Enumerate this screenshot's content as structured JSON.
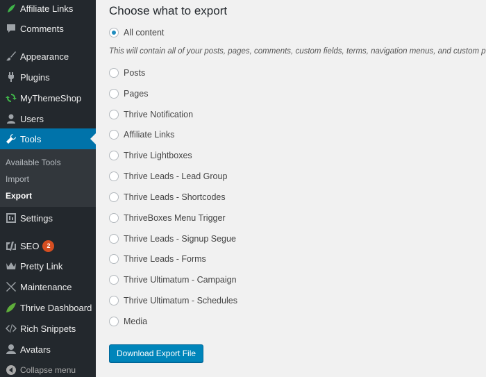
{
  "sidebar": {
    "items": [
      {
        "key": "affiliate",
        "label": "Affiliate Links",
        "icon": "leaf-icon"
      },
      {
        "key": "comments",
        "label": "Comments",
        "icon": "comment-icon"
      },
      {
        "key": "appearance",
        "label": "Appearance",
        "icon": "brush-icon"
      },
      {
        "key": "plugins",
        "label": "Plugins",
        "icon": "plug-icon"
      },
      {
        "key": "mythemeshop",
        "label": "MyThemeShop",
        "icon": "refresh-icon"
      },
      {
        "key": "users",
        "label": "Users",
        "icon": "user-icon"
      },
      {
        "key": "tools",
        "label": "Tools",
        "icon": "wrench-icon"
      },
      {
        "key": "settings",
        "label": "Settings",
        "icon": "settings-icon"
      },
      {
        "key": "seo",
        "label": "SEO",
        "icon": "yoast-icon",
        "badge": "2"
      },
      {
        "key": "prettylink",
        "label": "Pretty Link",
        "icon": "crown-icon"
      },
      {
        "key": "maintenance",
        "label": "Maintenance",
        "icon": "tools-icon"
      },
      {
        "key": "thrive",
        "label": "Thrive Dashboard",
        "icon": "thrive-leaf-icon"
      },
      {
        "key": "snippets",
        "label": "Rich Snippets",
        "icon": "code-icon"
      },
      {
        "key": "avatars",
        "label": "Avatars",
        "icon": "avatar-icon"
      }
    ],
    "submenu": [
      "Available Tools",
      "Import",
      "Export"
    ],
    "collapse_label": "Collapse menu"
  },
  "main": {
    "heading": "Choose what to export",
    "all_content_label": "All content",
    "description": "This will contain all of your posts, pages, comments, custom fields, terms, navigation menus, and custom posts.",
    "options": [
      "Posts",
      "Pages",
      "Thrive Notification",
      "Affiliate Links",
      "Thrive Lightboxes",
      "Thrive Leads - Lead Group",
      "Thrive Leads - Shortcodes",
      "ThriveBoxes Menu Trigger",
      "Thrive Leads - Signup Segue",
      "Thrive Leads - Forms",
      "Thrive Ultimatum - Campaign",
      "Thrive Ultimatum - Schedules",
      "Media"
    ],
    "button_label": "Download Export File"
  },
  "colors": {
    "sidebar_bg": "#23282d",
    "submenu_bg": "#32373c",
    "accent": "#0073aa",
    "button": "#0085ba",
    "badge": "#d54e21",
    "page_bg": "#f1f1f1"
  }
}
